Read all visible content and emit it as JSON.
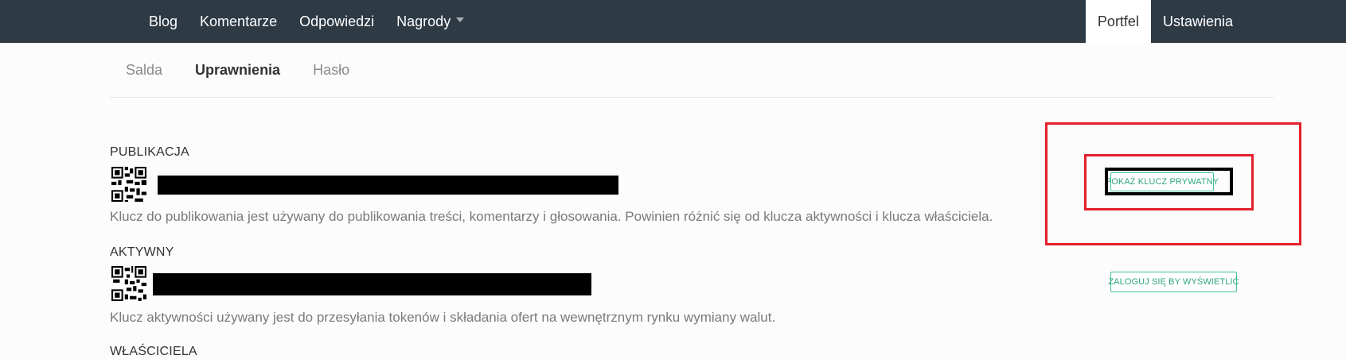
{
  "topnav": {
    "left": [
      {
        "label": "Blog"
      },
      {
        "label": "Komentarze"
      },
      {
        "label": "Odpowiedzi"
      },
      {
        "label": "Nagrody"
      }
    ],
    "right": [
      {
        "label": "Portfel"
      },
      {
        "label": "Ustawienia"
      }
    ]
  },
  "tabs": [
    {
      "label": "Salda"
    },
    {
      "label": "Uprawnienia"
    },
    {
      "label": "Hasło"
    }
  ],
  "sections": {
    "publikacja": {
      "title": "PUBLIKACJA",
      "description": "Klucz do publikowania jest używany do publikowania treści, komentarzy i głosowania. Powinien różnić się od klucza aktywności i klucza właściciela.",
      "button": "POKAŻ KLUCZ PRYWATNY"
    },
    "aktywny": {
      "title": "AKTYWNY",
      "description": "Klucz aktywności używany jest do przesyłania tokenów i składania ofert na wewnętrznym rynku wymiany walut.",
      "button": "ZALOGUJ SIĘ BY WYŚWIETLIĆ"
    },
    "wlasciciela": {
      "title": "WŁAŚCICIELA"
    }
  },
  "colors": {
    "topbar": "#2e3a44",
    "button_green": "#3fc18e",
    "highlight_red": "#e3202b"
  }
}
